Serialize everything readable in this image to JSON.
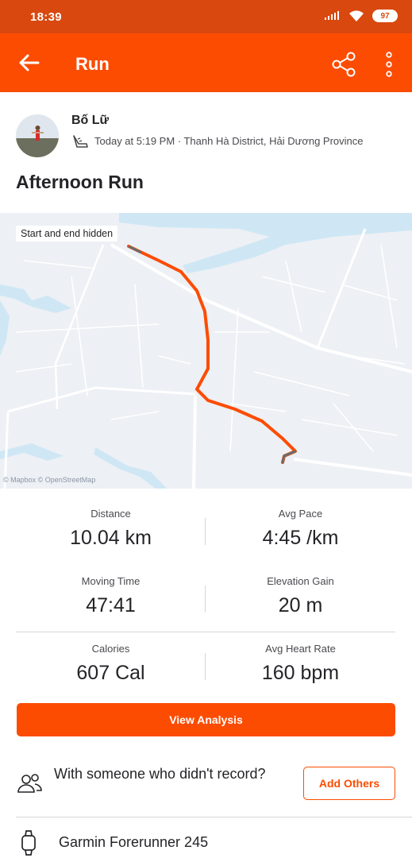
{
  "status_bar": {
    "time": "18:39",
    "battery": "97"
  },
  "app_bar": {
    "title": "Run"
  },
  "athlete": {
    "name": "Bố Lữ",
    "meta": "Today at 5:19 PM · Thanh Hà District, Hải Dương Province"
  },
  "activity": {
    "title": "Afternoon Run"
  },
  "map": {
    "privacy_note": "Start and end hidden",
    "attribution": "© Mapbox © OpenStreetMap",
    "route_color": "#fc4c02"
  },
  "stats": [
    {
      "label": "Distance",
      "value": "10.04 km"
    },
    {
      "label": "Avg Pace",
      "value": "4:45 /km"
    },
    {
      "label": "Moving Time",
      "value": "47:41"
    },
    {
      "label": "Elevation Gain",
      "value": "20 m"
    },
    {
      "label": "Calories",
      "value": "607 Cal"
    },
    {
      "label": "Avg Heart Rate",
      "value": "160 bpm"
    }
  ],
  "actions": {
    "view_analysis": "View Analysis",
    "with_others": "With someone who didn't record?",
    "add_others": "Add Others"
  },
  "device": {
    "name": "Garmin Forerunner 245"
  },
  "colors": {
    "brand": "#fc4c02",
    "status_bar": "#d9480f",
    "water": "#cfe7f5"
  },
  "icons": [
    "back-arrow-icon",
    "share-icon",
    "more-vertical-icon",
    "shoe-icon",
    "group-icon",
    "watch-icon",
    "mapbox-icon"
  ]
}
